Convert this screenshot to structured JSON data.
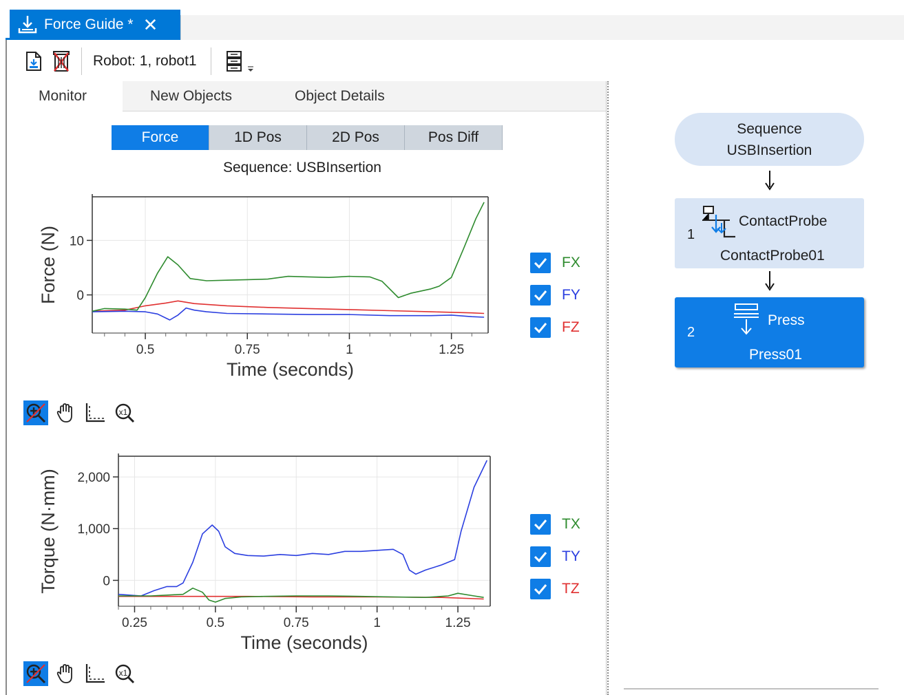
{
  "document_tab": {
    "title": "Force Guide *",
    "close_glyph": "✕"
  },
  "toolbar": {
    "robot_label": "Robot: 1, robot1",
    "icons": [
      "save-doc-icon",
      "delete-doc-icon",
      "steps-list-icon",
      "chevron-down-icon"
    ]
  },
  "subtabs": [
    "Monitor",
    "New Objects",
    "Object Details"
  ],
  "view_tabs": [
    "Force",
    "1D Pos",
    "2D Pos",
    "Pos Diff"
  ],
  "active_view_tab": "Force",
  "sequence_caption": "Sequence: USBInsertion",
  "chart_data": [
    {
      "type": "line",
      "ylabel": "Force (N)",
      "xlabel": "Time (seconds)",
      "xlim": [
        0.37,
        1.34
      ],
      "ylim": [
        -7,
        18
      ],
      "xticks": [
        0.5,
        0.75,
        1,
        1.25
      ],
      "xtick_labels": [
        "0.5",
        "0.75",
        "1",
        "1.25"
      ],
      "yticks": [
        0,
        10
      ],
      "ytick_labels": [
        "0",
        "10"
      ],
      "grid": true,
      "legend_placement": "right",
      "series": [
        {
          "name": "FX",
          "color": "#2e8b2e",
          "x": [
            0.37,
            0.4,
            0.45,
            0.48,
            0.5,
            0.53,
            0.555,
            0.58,
            0.61,
            0.65,
            0.7,
            0.75,
            0.8,
            0.85,
            0.9,
            0.95,
            1.0,
            1.05,
            1.08,
            1.12,
            1.15,
            1.2,
            1.22,
            1.25,
            1.28,
            1.31,
            1.33
          ],
          "values": [
            -3,
            -2.5,
            -2.6,
            -2.8,
            -0.5,
            4,
            7,
            5.5,
            3,
            2.6,
            2.7,
            2.8,
            2.9,
            3.4,
            3.3,
            3.2,
            3.4,
            3.3,
            2.5,
            -0.5,
            0.3,
            1.1,
            1.6,
            3.2,
            8.5,
            14,
            17
          ]
        },
        {
          "name": "FY",
          "color": "#2b3fe0",
          "x": [
            0.37,
            0.45,
            0.5,
            0.53,
            0.56,
            0.58,
            0.6,
            0.62,
            0.65,
            0.7,
            0.8,
            0.9,
            1.0,
            1.1,
            1.2,
            1.25,
            1.3,
            1.33
          ],
          "values": [
            -3.1,
            -3.0,
            -3.1,
            -3.5,
            -4.6,
            -3.7,
            -2.4,
            -2.8,
            -3.1,
            -3.4,
            -3.5,
            -3.6,
            -3.6,
            -3.8,
            -3.8,
            -3.7,
            -4.0,
            -4.1
          ]
        },
        {
          "name": "FZ",
          "color": "#e03030",
          "x": [
            0.37,
            0.45,
            0.5,
            0.55,
            0.58,
            0.62,
            0.7,
            0.8,
            0.9,
            1.0,
            1.1,
            1.2,
            1.3,
            1.33
          ],
          "values": [
            -3.0,
            -2.8,
            -2.0,
            -1.5,
            -1.1,
            -1.6,
            -2.0,
            -2.3,
            -2.5,
            -2.7,
            -2.9,
            -3.1,
            -3.3,
            -3.4
          ]
        }
      ]
    },
    {
      "type": "line",
      "ylabel": "Torque (N·mm)",
      "xlabel": "Time (seconds)",
      "xlim": [
        0.2,
        1.35
      ],
      "ylim": [
        -500,
        2400
      ],
      "xticks": [
        0.25,
        0.5,
        0.75,
        1,
        1.25
      ],
      "xtick_labels": [
        "0.25",
        "0.5",
        "0.75",
        "1",
        "1.25"
      ],
      "yticks": [
        0,
        1000,
        2000
      ],
      "ytick_labels": [
        "0",
        "1,000",
        "2,000"
      ],
      "grid": true,
      "legend_placement": "right",
      "series": [
        {
          "name": "TX",
          "color": "#2e8b2e",
          "x": [
            0.2,
            0.3,
            0.4,
            0.43,
            0.46,
            0.48,
            0.5,
            0.53,
            0.58,
            0.65,
            0.75,
            0.85,
            0.95,
            1.05,
            1.15,
            1.22,
            1.25,
            1.3,
            1.33
          ],
          "values": [
            -300,
            -300,
            -270,
            -150,
            -230,
            -380,
            -420,
            -350,
            -320,
            -310,
            -300,
            -300,
            -310,
            -320,
            -330,
            -300,
            -250,
            -300,
            -330
          ]
        },
        {
          "name": "TY",
          "color": "#2b3fe0",
          "x": [
            0.2,
            0.27,
            0.31,
            0.35,
            0.38,
            0.4,
            0.43,
            0.46,
            0.49,
            0.51,
            0.53,
            0.56,
            0.6,
            0.65,
            0.7,
            0.75,
            0.8,
            0.85,
            0.9,
            0.95,
            1.0,
            1.05,
            1.08,
            1.1,
            1.12,
            1.15,
            1.2,
            1.24,
            1.26,
            1.3,
            1.34
          ],
          "values": [
            -270,
            -300,
            -200,
            -120,
            -120,
            -50,
            350,
            900,
            1070,
            950,
            650,
            520,
            480,
            470,
            500,
            480,
            520,
            500,
            560,
            560,
            580,
            600,
            500,
            200,
            120,
            200,
            300,
            400,
            950,
            1800,
            2320
          ]
        },
        {
          "name": "TZ",
          "color": "#e03030",
          "x": [
            0.2,
            0.4,
            0.6,
            0.8,
            1.0,
            1.2,
            1.33
          ],
          "values": [
            -310,
            -310,
            -310,
            -320,
            -320,
            -330,
            -360
          ]
        }
      ]
    }
  ],
  "chart_tools": [
    "zoom-in-icon",
    "pan-hand-icon",
    "axis-select-icon",
    "zoom-reset-icon"
  ],
  "colors": {
    "accent": "#0f7de6",
    "tab_bar": "#0078d7",
    "node_fill": "#d9e5f5"
  },
  "flow": {
    "sequence_title": "Sequence",
    "sequence_name": "USBInsertion",
    "steps": [
      {
        "number": "1",
        "type": "ContactProbe",
        "name": "ContactProbe01",
        "selected": false
      },
      {
        "number": "2",
        "type": "Press",
        "name": "Press01",
        "selected": true
      }
    ]
  }
}
